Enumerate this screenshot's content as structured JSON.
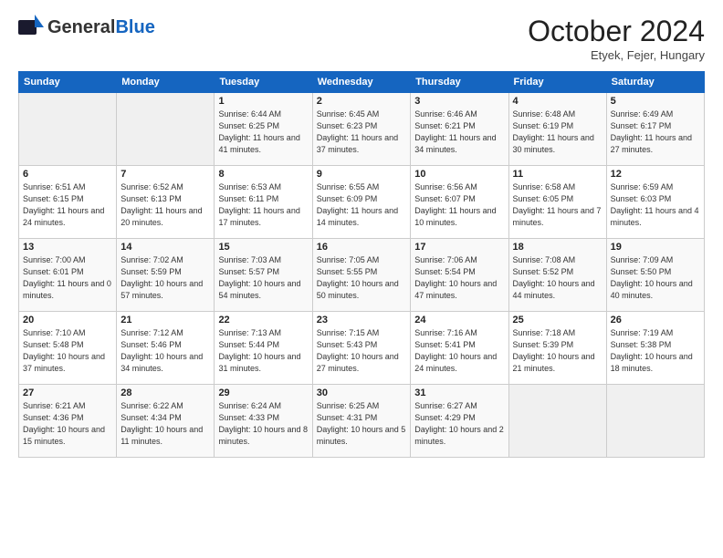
{
  "header": {
    "logo_general": "General",
    "logo_blue": "Blue",
    "month_title": "October 2024",
    "location": "Etyek, Fejer, Hungary"
  },
  "calendar": {
    "days_of_week": [
      "Sunday",
      "Monday",
      "Tuesday",
      "Wednesday",
      "Thursday",
      "Friday",
      "Saturday"
    ],
    "weeks": [
      [
        {
          "day": "",
          "detail": ""
        },
        {
          "day": "",
          "detail": ""
        },
        {
          "day": "1",
          "detail": "Sunrise: 6:44 AM\nSunset: 6:25 PM\nDaylight: 11 hours and 41 minutes."
        },
        {
          "day": "2",
          "detail": "Sunrise: 6:45 AM\nSunset: 6:23 PM\nDaylight: 11 hours and 37 minutes."
        },
        {
          "day": "3",
          "detail": "Sunrise: 6:46 AM\nSunset: 6:21 PM\nDaylight: 11 hours and 34 minutes."
        },
        {
          "day": "4",
          "detail": "Sunrise: 6:48 AM\nSunset: 6:19 PM\nDaylight: 11 hours and 30 minutes."
        },
        {
          "day": "5",
          "detail": "Sunrise: 6:49 AM\nSunset: 6:17 PM\nDaylight: 11 hours and 27 minutes."
        }
      ],
      [
        {
          "day": "6",
          "detail": "Sunrise: 6:51 AM\nSunset: 6:15 PM\nDaylight: 11 hours and 24 minutes."
        },
        {
          "day": "7",
          "detail": "Sunrise: 6:52 AM\nSunset: 6:13 PM\nDaylight: 11 hours and 20 minutes."
        },
        {
          "day": "8",
          "detail": "Sunrise: 6:53 AM\nSunset: 6:11 PM\nDaylight: 11 hours and 17 minutes."
        },
        {
          "day": "9",
          "detail": "Sunrise: 6:55 AM\nSunset: 6:09 PM\nDaylight: 11 hours and 14 minutes."
        },
        {
          "day": "10",
          "detail": "Sunrise: 6:56 AM\nSunset: 6:07 PM\nDaylight: 11 hours and 10 minutes."
        },
        {
          "day": "11",
          "detail": "Sunrise: 6:58 AM\nSunset: 6:05 PM\nDaylight: 11 hours and 7 minutes."
        },
        {
          "day": "12",
          "detail": "Sunrise: 6:59 AM\nSunset: 6:03 PM\nDaylight: 11 hours and 4 minutes."
        }
      ],
      [
        {
          "day": "13",
          "detail": "Sunrise: 7:00 AM\nSunset: 6:01 PM\nDaylight: 11 hours and 0 minutes."
        },
        {
          "day": "14",
          "detail": "Sunrise: 7:02 AM\nSunset: 5:59 PM\nDaylight: 10 hours and 57 minutes."
        },
        {
          "day": "15",
          "detail": "Sunrise: 7:03 AM\nSunset: 5:57 PM\nDaylight: 10 hours and 54 minutes."
        },
        {
          "day": "16",
          "detail": "Sunrise: 7:05 AM\nSunset: 5:55 PM\nDaylight: 10 hours and 50 minutes."
        },
        {
          "day": "17",
          "detail": "Sunrise: 7:06 AM\nSunset: 5:54 PM\nDaylight: 10 hours and 47 minutes."
        },
        {
          "day": "18",
          "detail": "Sunrise: 7:08 AM\nSunset: 5:52 PM\nDaylight: 10 hours and 44 minutes."
        },
        {
          "day": "19",
          "detail": "Sunrise: 7:09 AM\nSunset: 5:50 PM\nDaylight: 10 hours and 40 minutes."
        }
      ],
      [
        {
          "day": "20",
          "detail": "Sunrise: 7:10 AM\nSunset: 5:48 PM\nDaylight: 10 hours and 37 minutes."
        },
        {
          "day": "21",
          "detail": "Sunrise: 7:12 AM\nSunset: 5:46 PM\nDaylight: 10 hours and 34 minutes."
        },
        {
          "day": "22",
          "detail": "Sunrise: 7:13 AM\nSunset: 5:44 PM\nDaylight: 10 hours and 31 minutes."
        },
        {
          "day": "23",
          "detail": "Sunrise: 7:15 AM\nSunset: 5:43 PM\nDaylight: 10 hours and 27 minutes."
        },
        {
          "day": "24",
          "detail": "Sunrise: 7:16 AM\nSunset: 5:41 PM\nDaylight: 10 hours and 24 minutes."
        },
        {
          "day": "25",
          "detail": "Sunrise: 7:18 AM\nSunset: 5:39 PM\nDaylight: 10 hours and 21 minutes."
        },
        {
          "day": "26",
          "detail": "Sunrise: 7:19 AM\nSunset: 5:38 PM\nDaylight: 10 hours and 18 minutes."
        }
      ],
      [
        {
          "day": "27",
          "detail": "Sunrise: 6:21 AM\nSunset: 4:36 PM\nDaylight: 10 hours and 15 minutes."
        },
        {
          "day": "28",
          "detail": "Sunrise: 6:22 AM\nSunset: 4:34 PM\nDaylight: 10 hours and 11 minutes."
        },
        {
          "day": "29",
          "detail": "Sunrise: 6:24 AM\nSunset: 4:33 PM\nDaylight: 10 hours and 8 minutes."
        },
        {
          "day": "30",
          "detail": "Sunrise: 6:25 AM\nSunset: 4:31 PM\nDaylight: 10 hours and 5 minutes."
        },
        {
          "day": "31",
          "detail": "Sunrise: 6:27 AM\nSunset: 4:29 PM\nDaylight: 10 hours and 2 minutes."
        },
        {
          "day": "",
          "detail": ""
        },
        {
          "day": "",
          "detail": ""
        }
      ]
    ]
  }
}
